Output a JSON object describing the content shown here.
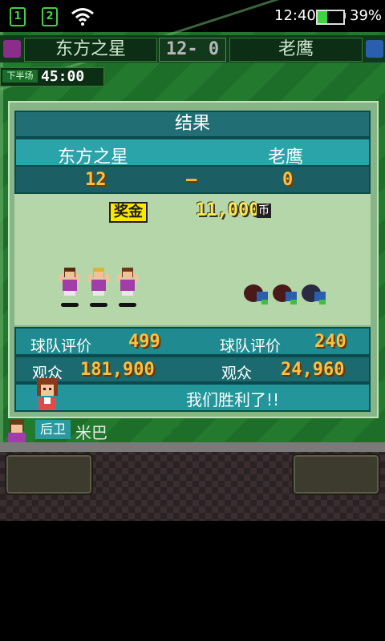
{
  "status_bar": {
    "sim1": "1",
    "sim2": "2",
    "time": "12:40",
    "battery_percent": "39%",
    "battery_level": 0.39
  },
  "scoreboard": {
    "home_team": "东方之星",
    "score": "12- 0",
    "away_team": "老鹰",
    "home_jersey_color": "#8a2e8c",
    "away_jersey_color": "#2a5fb0",
    "period": "下半场",
    "clock": "45:00"
  },
  "result": {
    "title": "结果",
    "home_team": "东方之星",
    "away_team": "老鹰",
    "home_score": "12",
    "separator": "–",
    "away_score": "0",
    "prize_label": "奖金",
    "prize_amount": "11,000",
    "prize_unit": "币",
    "home_rating_label": "球队评价",
    "home_rating": "499",
    "away_rating_label": "球队评价",
    "away_rating": "240",
    "home_attendance_label": "观众",
    "home_attendance": "181,900",
    "away_attendance_label": "观众",
    "away_attendance": "24,960",
    "message": "我们胜利了!!"
  },
  "player_bar": {
    "role": "后卫",
    "name": "米巴"
  },
  "colors": {
    "panel_teal": "#1f8a8f",
    "score_gold": "#ffbf3a",
    "prize_yellow": "#ffe600"
  }
}
